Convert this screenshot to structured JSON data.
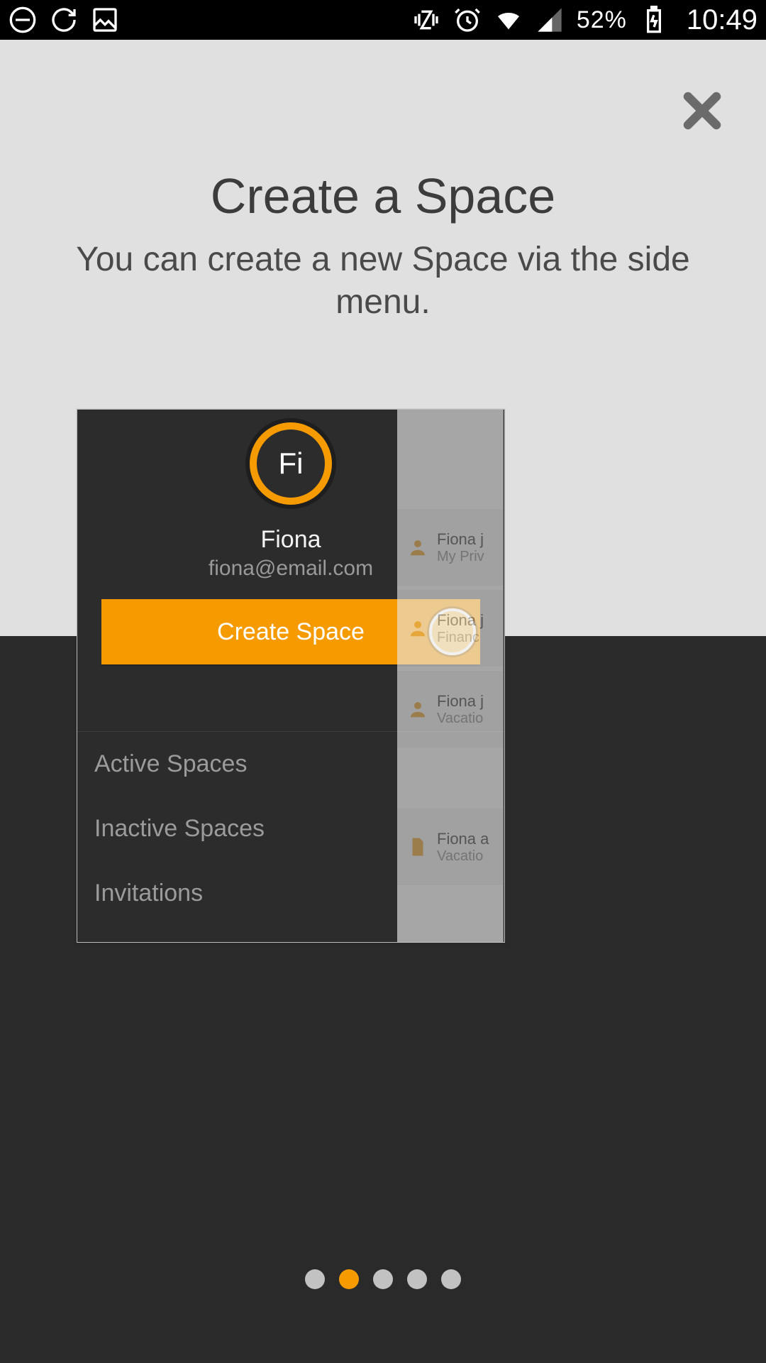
{
  "status_bar": {
    "battery_text": "52%",
    "time": "10:49"
  },
  "onboarding": {
    "title": "Create a Space",
    "subtitle": "You can create a new Space via the side menu.",
    "page_count": 5,
    "active_page_index": 1
  },
  "mock": {
    "avatar_initials": "Fi",
    "user_name": "Fiona",
    "user_email": "fiona@email.com",
    "create_button_label": "Create Space",
    "menu_items": [
      "Active Spaces",
      "Inactive Spaces",
      "Invitations"
    ],
    "right_panel_items": [
      {
        "line1": "Fiona j",
        "line2": "My Priv",
        "icon": "person"
      },
      {
        "line1": "Fiona j",
        "line2": "Financ",
        "icon": "person"
      },
      {
        "line1": "Fiona j",
        "line2": "Vacatio",
        "icon": "person"
      },
      {
        "line1": "Fiona a",
        "line2": "Vacatio",
        "icon": "doc"
      }
    ]
  },
  "colors": {
    "accent": "#f59b00",
    "dark": "#2a2a2a",
    "light": "#e0e0e0"
  }
}
